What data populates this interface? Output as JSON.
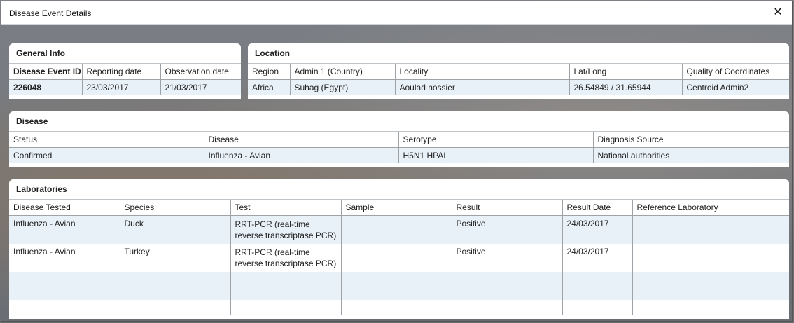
{
  "dialog": {
    "title": "Disease Event Details",
    "close_glyph": "✕"
  },
  "general_info": {
    "header": "General Info",
    "columns": [
      "Disease Event ID",
      "Reporting date",
      "Observation date"
    ],
    "row": [
      "226048",
      "23/03/2017",
      "21/03/2017"
    ]
  },
  "location": {
    "header": "Location",
    "columns": [
      "Region",
      "Admin 1 (Country)",
      "Locality",
      "Lat/Long",
      "Quality of Coordinates"
    ],
    "row": [
      "Africa",
      "Suhag (Egypt)",
      "Aoulad nossier",
      "26.54849 / 31.65944",
      "Centroid Admin2"
    ]
  },
  "disease": {
    "header": "Disease",
    "columns": [
      "Status",
      "Disease",
      "Serotype",
      "Diagnosis Source"
    ],
    "row": [
      "Confirmed",
      "Influenza - Avian",
      "H5N1 HPAI",
      "National authorities"
    ]
  },
  "laboratories": {
    "header": "Laboratories",
    "columns": [
      "Disease Tested",
      "Species",
      "Test",
      "Sample",
      "Result",
      "Result Date",
      "Reference Laboratory"
    ],
    "rows": [
      [
        "Influenza - Avian",
        "Duck",
        "RRT-PCR (real-time reverse transcriptase PCR)",
        "",
        "Positive",
        "24/03/2017",
        ""
      ],
      [
        "Influenza - Avian",
        "Turkey",
        "RRT-PCR (real-time reverse transcriptase PCR)",
        "",
        "Positive",
        "24/03/2017",
        ""
      ]
    ]
  }
}
